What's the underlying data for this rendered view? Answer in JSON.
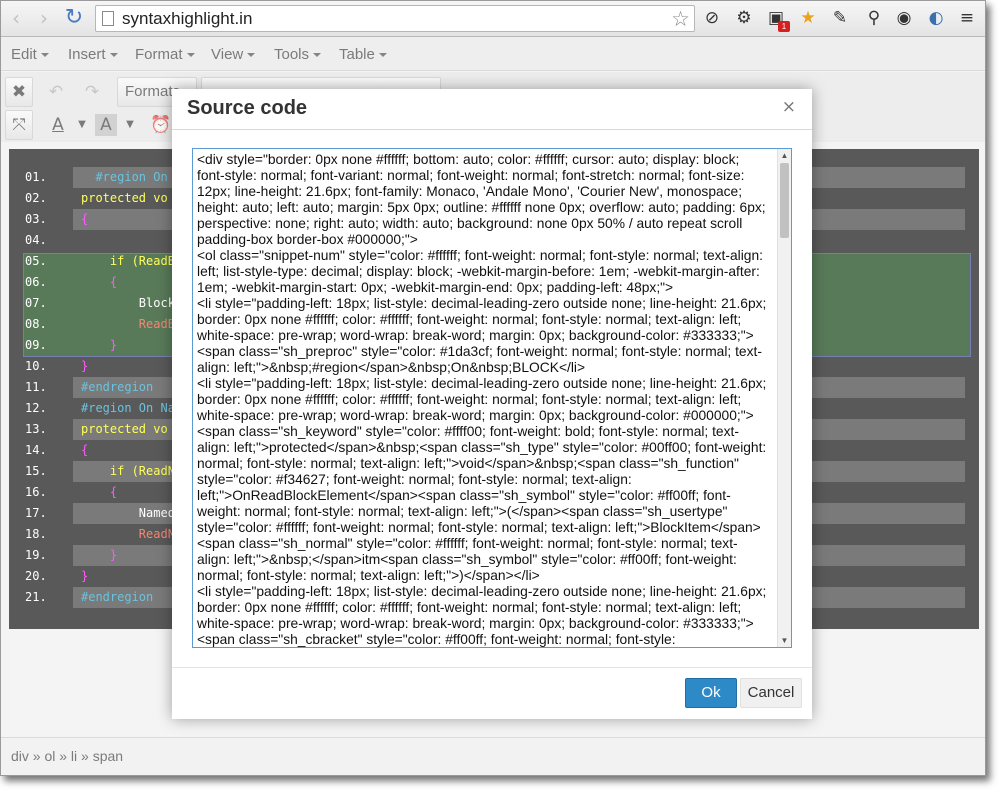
{
  "browser": {
    "url": "syntaxhighlight.in",
    "ext_badge": "1"
  },
  "menubar": {
    "items": [
      {
        "label": "Edit"
      },
      {
        "label": "Insert"
      },
      {
        "label": "Format"
      },
      {
        "label": "View"
      },
      {
        "label": "Tools"
      },
      {
        "label": "Table"
      }
    ]
  },
  "toolbar": {
    "formats_label": "Formats"
  },
  "code_lines": [
    {
      "num": "01.",
      "text": "  #region On B",
      "color": "#1da3cf",
      "bg": "dark"
    },
    {
      "num": "02.",
      "text": "protected vo",
      "color": "#ffff00",
      "bg": "none"
    },
    {
      "num": "03.",
      "text": "{",
      "color": "#ff00ff",
      "bg": "dark"
    },
    {
      "num": "04.",
      "text": "",
      "color": "#ffffff",
      "bg": "none"
    },
    {
      "num": "05.",
      "text": "    if (ReadB",
      "color": "#ffff00",
      "bg": "hl"
    },
    {
      "num": "06.",
      "text": "    {",
      "color": "#ff00ff",
      "bg": "hl"
    },
    {
      "num": "07.",
      "text": "        Block",
      "color": "#ffffff",
      "bg": "hl"
    },
    {
      "num": "08.",
      "text": "        ReadB",
      "color": "#f34627",
      "bg": "hl"
    },
    {
      "num": "09.",
      "text": "    }",
      "color": "#ff00ff",
      "bg": "hl"
    },
    {
      "num": "10.",
      "text": "}",
      "color": "#ff00ff",
      "bg": "none"
    },
    {
      "num": "11.",
      "text": "#endregion",
      "color": "#1da3cf",
      "bg": "dark"
    },
    {
      "num": "12.",
      "text": "#region On Na",
      "color": "#1da3cf",
      "bg": "none"
    },
    {
      "num": "13.",
      "text": "protected vo",
      "color": "#ffff00",
      "bg": "dark"
    },
    {
      "num": "14.",
      "text": "{",
      "color": "#ff00ff",
      "bg": "none"
    },
    {
      "num": "15.",
      "text": "    if (ReadN",
      "color": "#ffff00",
      "bg": "dark"
    },
    {
      "num": "16.",
      "text": "    {",
      "color": "#ff00ff",
      "bg": "none"
    },
    {
      "num": "17.",
      "text": "        Named",
      "color": "#ffffff",
      "bg": "dark"
    },
    {
      "num": "18.",
      "text": "        ReadN",
      "color": "#f34627",
      "bg": "none"
    },
    {
      "num": "19.",
      "text": "    }",
      "color": "#ff00ff",
      "bg": "dark"
    },
    {
      "num": "20.",
      "text": "}",
      "color": "#ff00ff",
      "bg": "none"
    },
    {
      "num": "21.",
      "text": "#endregion",
      "color": "#1da3cf",
      "bg": "dark"
    }
  ],
  "statusbar": {
    "path": "div » ol » li » span"
  },
  "dialog": {
    "title": "Source code",
    "close_symbol": "×",
    "source": "<div style=\"border: 0px none #ffffff; bottom: auto; color: #ffffff; cursor: auto; display: block; font-style: normal; font-variant: normal; font-weight: normal; font-stretch: normal; font-size: 12px; line-height: 21.6px; font-family: Monaco, 'Andale Mono', 'Courier New', monospace; height: auto; left: auto; margin: 5px 0px; outline: #ffffff none 0px; overflow: auto; padding: 6px; perspective: none; right: auto; width: auto; background: none 0px 50% / auto repeat scroll padding-box border-box #000000;\">\n<ol class=\"snippet-num\" style=\"color: #ffffff; font-weight: normal; font-style: normal; text-align: left; list-style-type: decimal; display: block; -webkit-margin-before: 1em; -webkit-margin-after: 1em; -webkit-margin-start: 0px; -webkit-margin-end: 0px; padding-left: 48px;\">\n<li style=\"padding-left: 18px; list-style: decimal-leading-zero outside none; line-height: 21.6px; border: 0px none #ffffff; color: #ffffff; font-weight: normal; font-style: normal; text-align: left; white-space: pre-wrap; word-wrap: break-word; margin: 0px; background-color: #333333;\"><span class=\"sh_preproc\" style=\"color: #1da3cf; font-weight: normal; font-style: normal; text-align: left;\">&nbsp;#region</span>&nbsp;On&nbsp;BLOCK</li>\n<li style=\"padding-left: 18px; list-style: decimal-leading-zero outside none; line-height: 21.6px; border: 0px none #ffffff; color: #ffffff; font-weight: normal; font-style: normal; text-align: left; white-space: pre-wrap; word-wrap: break-word; margin: 0px; background-color: #000000;\"><span class=\"sh_keyword\" style=\"color: #ffff00; font-weight: bold; font-style: normal; text-align: left;\">protected</span>&nbsp;<span class=\"sh_type\" style=\"color: #00ff00; font-weight: normal; font-style: normal; text-align: left;\">void</span>&nbsp;<span class=\"sh_function\" style=\"color: #f34627; font-weight: normal; font-style: normal; text-align: left;\">OnReadBlockElement</span><span class=\"sh_symbol\" style=\"color: #ff00ff; font-weight: normal; font-style: normal; text-align: left;\">(</span><span class=\"sh_usertype\" style=\"color: #ffffff; font-weight: normal; font-style: normal; text-align: left;\">BlockItem</span> <span class=\"sh_normal\" style=\"color: #ffffff; font-weight: normal; font-style: normal; text-align: left;\">&nbsp;</span>itm<span class=\"sh_symbol\" style=\"color: #ff00ff; font-weight: normal; font-style: normal; text-align: left;\">)</span></li>\n<li style=\"padding-left: 18px; list-style: decimal-leading-zero outside none; line-height: 21.6px; border: 0px none #ffffff; color: #ffffff; font-weight: normal; font-style: normal; text-align: left; white-space: pre-wrap; word-wrap: break-word; margin: 0px; background-color: #333333;\"><span class=\"sh_cbracket\" style=\"color: #ff00ff; font-weight: normal; font-style:",
    "ok_label": "Ok",
    "cancel_label": "Cancel"
  },
  "colors": {
    "accent": "#2d8ac7",
    "code_bg": "#000000",
    "row_dark": "#333333",
    "highlight_bg": "#003300"
  }
}
